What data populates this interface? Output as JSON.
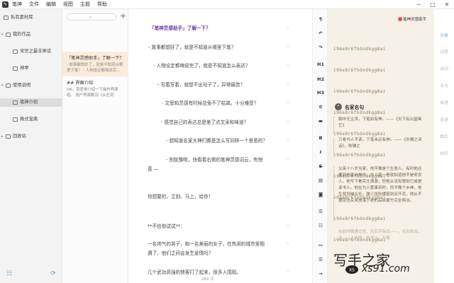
{
  "menubar": {
    "app_name": "笔神",
    "items": [
      "文件",
      "编辑",
      "视图",
      "主题",
      "帮助"
    ],
    "controls": [
      "─",
      "□",
      "✕"
    ]
  },
  "sidebar": {
    "items": [
      {
        "label": "私有素材库",
        "icon": "box-icon",
        "caret": ""
      },
      {
        "label": "我的作品",
        "icon": "folder-icon",
        "caret": "▾"
      },
      {
        "label": "宋世之最丰神话",
        "icon": "doc-icon",
        "caret": ""
      },
      {
        "label": "神甲",
        "icon": "doc-icon",
        "caret": ""
      },
      {
        "label": "使用说明",
        "icon": "folder-icon",
        "caret": "▾"
      },
      {
        "label": "笔神介绍",
        "icon": "doc-icon",
        "caret": ""
      },
      {
        "label": "格式宝典",
        "icon": "doc-icon",
        "caret": ""
      },
      {
        "label": "回收站",
        "icon": "trash-icon",
        "caret": "▸"
      }
    ],
    "footer": {
      "left_icon": "settings-sliders-icon",
      "right_icon": "sync-icon"
    }
  },
  "notelist": {
    "search_placeholder": "",
    "add_label": "+",
    "notes": [
      {
        "title": "「笔神灵感助手」了解一下？",
        "snippet": "- 故事都想好了，就是不知道从哪里下笔？ - 人物设定都嗨说完..."
      },
      {
        "title": "## 界面介绍",
        "snippet": "OK，我差单介绍一下操作界面 组。    用户界面概况（从左到"
      }
    ]
  },
  "editor": {
    "lines": [
      {
        "text": "「笔神灵感助手」了解一下？",
        "style": "heading"
      },
      {
        "text": "- 故事都想好了，就是不知道从哪里下笔？",
        "style": "normal"
      },
      {
        "text": "- 人物设定都嗨说完了，就是不知道怎么表达？",
        "style": "normal"
      },
      {
        "text": "- 写着写着，就想不出句子了，异常痛苦？",
        "style": "normal"
      },
      {
        "text": "- 文思和灵感有时候总免不了枯竭，十分难受？",
        "style": "normal"
      },
      {
        "text": "- 感觉自己的表达总是差了点文采和味道？",
        "style": "normal"
      },
      {
        "text": "- 想知道名家大神们都是怎么写同样一个意思的？",
        "style": "normal"
      },
      {
        "text": "- 别犹豫啦，快看看右侧的笔神灵感词云，有惊",
        "style": "normal"
      },
      {
        "text": "喜 —",
        "style": "normal"
      },
      {
        "text": "你想要的，立刻、马上，给你！",
        "style": "normal"
      },
      {
        "text": "**不信你试试**：",
        "style": "strong"
      },
      {
        "text": "一名帅气的男子，和一名美丽的女子，在热闹的城市里相",
        "style": "normal"
      },
      {
        "text": "遇了，他们之间会发生爱情吗？",
        "style": "normal"
      },
      {
        "text": "几个武功高强的侠客打了起来，很多人围观。",
        "style": "normal"
      }
    ],
    "word_count": "282 字"
  },
  "toolbar": {
    "buttons": [
      {
        "label": "¶",
        "icon": "paint-roller-icon"
      },
      {
        "label": "↶",
        "icon": "undo-icon"
      },
      {
        "label": "↷",
        "icon": "redo-icon"
      },
      {
        "label": "H1",
        "icon": "heading1-icon"
      },
      {
        "label": "H2",
        "icon": "heading2-icon"
      },
      {
        "label": "H3",
        "icon": "heading3-icon"
      },
      {
        "label": "≡",
        "icon": "paragraph-icon"
      },
      {
        "label": "▬",
        "icon": "comment-icon"
      },
      {
        "label": "B",
        "icon": "bold-icon"
      },
      {
        "label": "I",
        "icon": "italic-icon"
      },
      {
        "label": "S",
        "icon": "strikethrough-icon"
      },
      {
        "label": "▤",
        "icon": "quote-block-icon"
      },
      {
        "label": "◙",
        "icon": "code-icon"
      },
      {
        "label": "☰",
        "icon": "unordered-list-icon"
      },
      {
        "label": "☷",
        "icon": "ordered-list-icon"
      },
      {
        "label": "⚯",
        "icon": "link-icon"
      },
      {
        "label": "☰",
        "icon": "list-icon"
      },
      {
        "label": "→",
        "icon": "next-icon"
      }
    ]
  },
  "assistant": {
    "title": "笔神灵感助手",
    "grid_rows": [
      "i96e8r6fkOndkgg8ai",
      "i96e8r6fkOndkgg8ai",
      "i96e8r6fkOndkgg8ai",
      "i96e8r6fkOndkgg8ai",
      "i96e8r6fkOndkgg8ai",
      "i96e8r6fkOndkgg8ai",
      "i96e8r6fkOndkgg8ai",
      "i96e8r6fkOndkgg8ai",
      "i96e8r6fkOndkgg8ai",
      "i96e8r6fkOndkgg8ai"
    ],
    "quote_section_title": "名家名句",
    "quotes": [
      "胸中无尘滓，下笔如有神。——《天下有山堂画艺》",
      "万卷书人不读，下笔未必有神。——《孙辅之诗话》，陈辅之",
      "父亲十八岁当家，他不像是个生意人。有时他还要到他家去种作，亦人家一看就知道他不是务农人。他写下看实文清澈，但他从没有想到已成是读书人。他在为人管事到时，而不像个乡绅，他生就领袖众乐，弹三弦吹横笛到足开花，他从不摆设也从来放落于老的品丝黄竹完全两派。",
      "在前时期通过官，凡后不有过——，无实的出，为——人中的，的书上，万案"
    ]
  },
  "categories": {
    "active": "分类",
    "items": [
      "分类",
      "词语",
      "诗词",
      "名句",
      "成语",
      "谚语",
      "歇后",
      "规范"
    ]
  },
  "watermark": {
    "main": "写手之家",
    "domain": "xs91.com"
  }
}
